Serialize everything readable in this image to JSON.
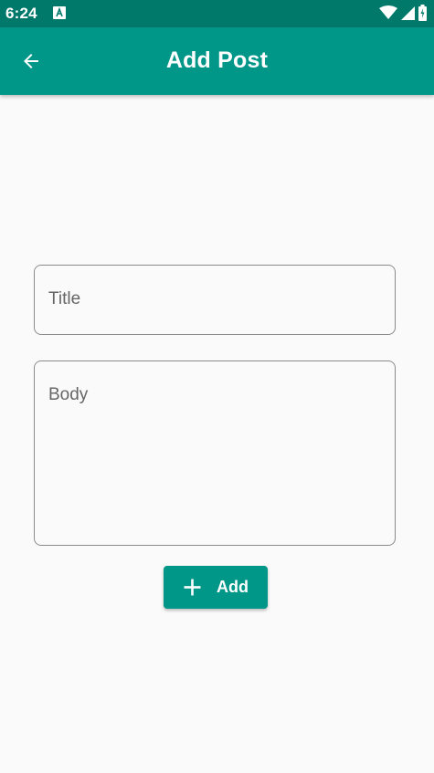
{
  "status_bar": {
    "time": "6:24",
    "icons": [
      "keyboard-a-icon",
      "wifi-icon",
      "signal-icon",
      "battery-icon"
    ]
  },
  "app_bar": {
    "title": "Add Post",
    "back_icon": "arrow-back-icon"
  },
  "form": {
    "title_placeholder": "Title",
    "body_placeholder": "Body",
    "add_button_label": "Add",
    "add_icon": "plus-icon"
  },
  "colors": {
    "primary": "#009688",
    "status_bar": "#00796b",
    "background": "#fafafa"
  }
}
